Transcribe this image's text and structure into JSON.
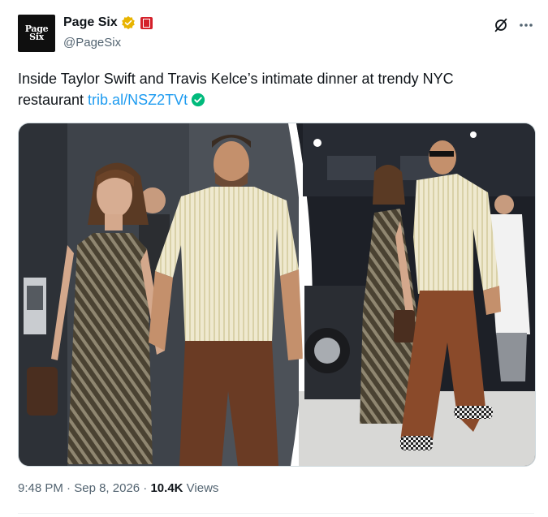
{
  "author": {
    "display_name": "Page Six",
    "handle": "@PageSix",
    "avatar_text": [
      "Page",
      "Six"
    ],
    "verified_color": "#e8b400"
  },
  "tweet": {
    "text": "Inside Taylor Swift and Travis Kelce’s intimate dinner at trendy NYC restaurant ",
    "link_text": "trib.al/NSZ2TVt",
    "link_check_color": "#00ba7c"
  },
  "meta": {
    "time": "9:48 PM",
    "sep": " · ",
    "date": "Sep 8, 2026",
    "views_count": "10.4K",
    "views_label": " Views"
  },
  "icons": {
    "grok": "grok-icon",
    "more": "more-icon"
  },
  "colors": {
    "link": "#1d9bf0",
    "secondary_text": "#536471"
  }
}
